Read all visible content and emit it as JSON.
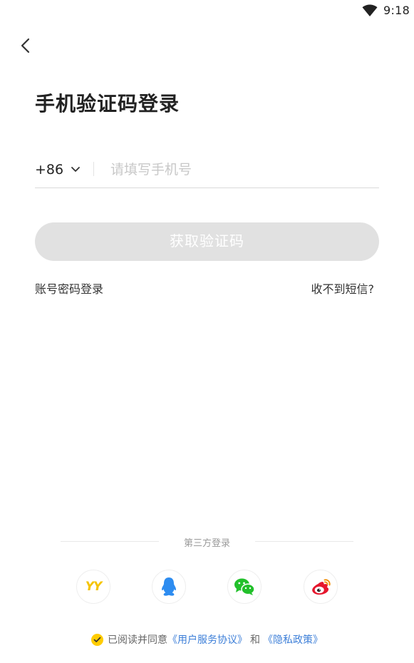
{
  "status_bar": {
    "time": "9:18",
    "icons": [
      "wifi-icon"
    ]
  },
  "header": {
    "back_icon": "chevron-left-icon",
    "title": "手机验证码登录"
  },
  "phone": {
    "country_code": "+86",
    "dropdown_icon": "chevron-down-icon",
    "placeholder": "请填写手机号",
    "value": ""
  },
  "actions": {
    "get_code_label": "获取验证码",
    "password_login_label": "账号密码登录",
    "no_sms_label": "收不到短信?"
  },
  "third_party": {
    "label": "第三方登录",
    "providers": [
      {
        "name": "YY",
        "icon": "yy-icon",
        "color": "#f5c400"
      },
      {
        "name": "QQ",
        "icon": "qq-penguin-icon",
        "color": "#2d8cf0"
      },
      {
        "name": "WeChat",
        "icon": "wechat-icon",
        "color": "#22c02b"
      },
      {
        "name": "Weibo",
        "icon": "weibo-icon",
        "color": "#e6162d"
      }
    ]
  },
  "agreement": {
    "checked": true,
    "prefix": "已阅读并同意",
    "terms_link": "《用户服务协议》",
    "and": "和",
    "privacy_link": "《隐私政策》"
  },
  "colors": {
    "accent": "#ffcc00",
    "link": "#3d7fd8",
    "button_disabled": "#e1e1e1"
  }
}
